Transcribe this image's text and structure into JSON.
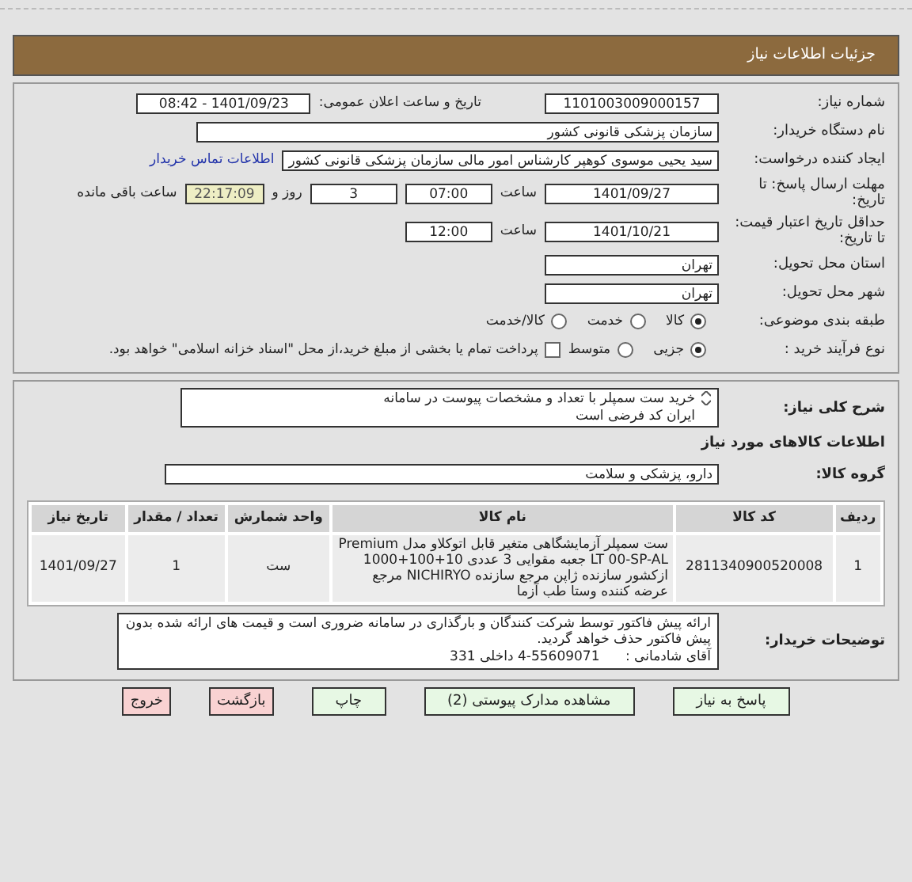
{
  "header": {
    "title": "جزئیات اطلاعات نیاز"
  },
  "need_number": {
    "label": "شماره نیاز:",
    "value": "1101003009000157"
  },
  "announce": {
    "label": "تاریخ و ساعت اعلان عمومی:",
    "value": "1401/09/23 - 08:42"
  },
  "buyer_org": {
    "label": "نام دستگاه خریدار:",
    "value": "سازمان پزشکی قانونی کشور"
  },
  "requester": {
    "label": "ایجاد کننده درخواست:",
    "value": "سید یحیی موسوی کوهپر کارشناس امور مالی سازمان پزشکی قانونی کشور",
    "link": "اطلاعات تماس خریدار"
  },
  "deadline": {
    "label": "مهلت ارسال پاسخ: تا تاریخ:",
    "date": "1401/09/27",
    "time_label": "ساعت",
    "time": "07:00",
    "days": "3",
    "days_label": "روز و",
    "remaining": "22:17:09",
    "remaining_label": "ساعت باقی مانده"
  },
  "validity": {
    "label": "حداقل تاریخ اعتبار قیمت: تا تاریخ:",
    "date": "1401/10/21",
    "time_label": "ساعت",
    "time": "12:00"
  },
  "province": {
    "label": "استان محل تحویل:",
    "value": "تهران"
  },
  "city": {
    "label": "شهر محل تحویل:",
    "value": "تهران"
  },
  "category": {
    "label": "طبقه بندی موضوعی:",
    "options": [
      {
        "label": "کالا",
        "selected": true
      },
      {
        "label": "خدمت",
        "selected": false
      },
      {
        "label": "کالا/خدمت",
        "selected": false
      }
    ]
  },
  "process": {
    "label": "نوع فرآیند خرید :",
    "options": [
      {
        "label": "جزیی",
        "selected": true
      },
      {
        "label": "متوسط",
        "selected": false
      }
    ],
    "payment": {
      "label": "پرداخت تمام یا بخشی از مبلغ خرید،از محل \"اسناد خزانه اسلامی\" خواهد بود.",
      "checked": false
    }
  },
  "summary": {
    "label": "شرح کلی نیاز:",
    "lines": [
      "خرید ست سمپلر با تعداد و مشخصات پیوست در سامانه",
      "ایران کد فرضی است"
    ]
  },
  "goods_title": "اطلاعات کالاهای مورد نیاز",
  "group": {
    "label": "گروه کالا:",
    "value": "دارو، پزشکی و سلامت"
  },
  "table": {
    "columns": [
      "ردیف",
      "کد کالا",
      "نام کالا",
      "واحد شمارش",
      "تعداد / مقدار",
      "تاریخ نیاز"
    ],
    "rows": [
      [
        "1",
        "2811340900520008",
        "ست سمپلر آزمایشگاهی متغیر قابل اتوکلاو مدل Premium LT 00-SP-AL جعبه مقوایی 3 عددی 10+100+1000 ازکشور سازنده ژاپن مرجع سازنده NICHIRYO مرجع عرضه کننده وستا طب آزما",
        "ست",
        "1",
        "1401/09/27"
      ]
    ]
  },
  "notes": {
    "label": "توضیحات خریدار:",
    "lines": [
      "ارائه پیش فاکتور توسط شرکت کنندگان و بارگذاری در سامانه ضروری است و قیمت های ارائه شده بدون پیش فاکتور حذف خواهد گردید.",
      "آقای شادمانی :      55609071-4 داخلی 331"
    ]
  },
  "buttons": [
    {
      "label": "پاسخ به نیاز",
      "kind": "primary"
    },
    {
      "label": "مشاهده مدارک پیوستی (2)",
      "kind": "primary"
    },
    {
      "label": "چاپ",
      "kind": "primary"
    },
    {
      "label": "بازگشت",
      "kind": "danger"
    },
    {
      "label": "خروج",
      "kind": "danger"
    }
  ]
}
